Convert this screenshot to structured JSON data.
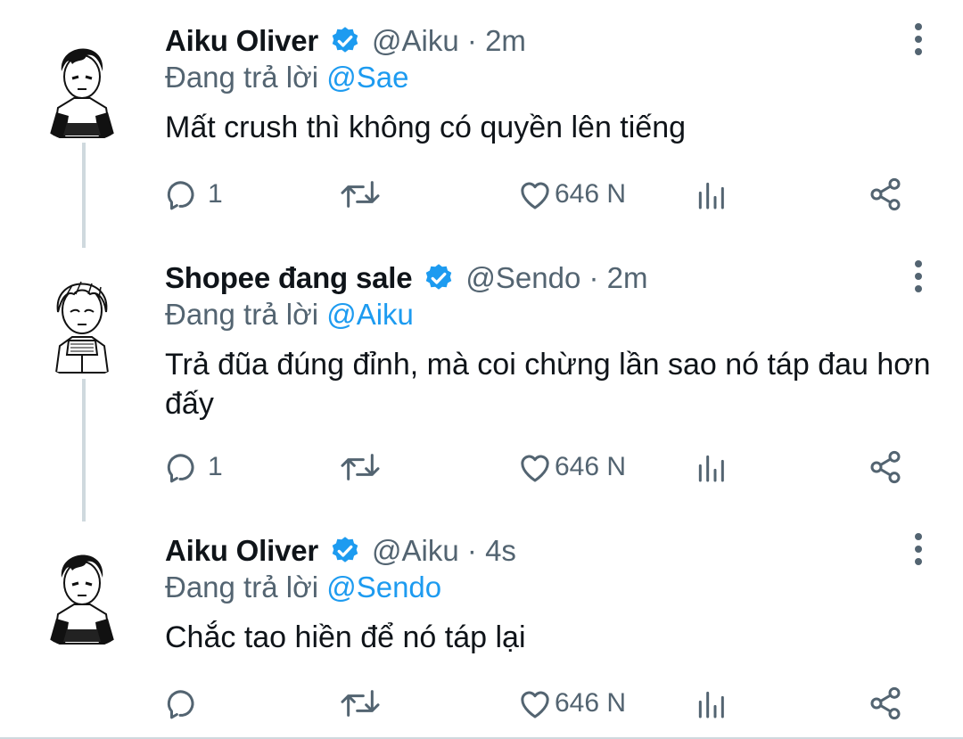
{
  "colors": {
    "accent": "#1d9bf0",
    "text": "#0f1419",
    "secondary": "#536471",
    "thread_line": "#cfd9de"
  },
  "tweets": [
    {
      "name": "Aiku Oliver",
      "handle": "@Aiku",
      "time": "2m",
      "reply_prefix": "Đang trả lời",
      "reply_to": "@Sae",
      "text": "Mất crush thì không có quyền lên tiếng",
      "replies": "1",
      "likes": "646 N",
      "avatar_icon": "dark-hair-anime-avatar"
    },
    {
      "name": "Shopee đang sale",
      "handle": "@Sendo",
      "time": "2m",
      "reply_prefix": "Đang trả lời",
      "reply_to": "@Aiku",
      "text": "Trả đũa đúng đỉnh, mà coi chừng lần sao nó táp đau hơn đấy",
      "replies": "1",
      "likes": "646 N",
      "avatar_icon": "light-hair-anime-avatar"
    },
    {
      "name": "Aiku Oliver",
      "handle": "@Aiku",
      "time": "4s",
      "reply_prefix": "Đang trả lời",
      "reply_to": "@Sendo",
      "text": "Chắc tao hiền để nó táp lại",
      "replies": "",
      "likes": "646 N",
      "avatar_icon": "dark-hair-anime-avatar"
    }
  ]
}
